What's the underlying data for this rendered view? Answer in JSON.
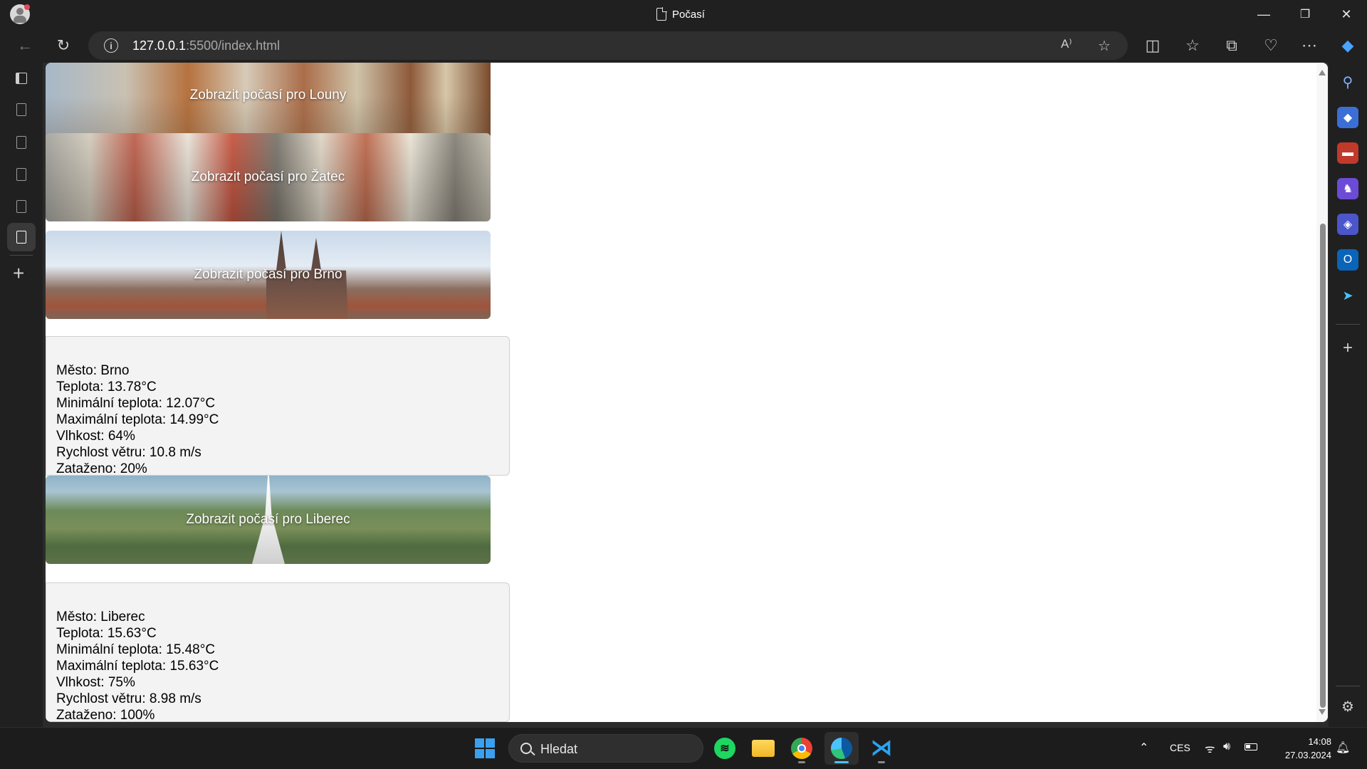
{
  "window": {
    "tab_title": "Počasí",
    "minimize": "—",
    "restore": "❐",
    "close": "✕"
  },
  "toolbar": {
    "url_host": "127.0.0.1",
    "url_rest": ":5500/index.html"
  },
  "page": {
    "banners": [
      {
        "label": "Zobrazit počasí pro Louny"
      },
      {
        "label": "Zobrazit počasí pro Žatec"
      },
      {
        "label": "Zobrazit počasí pro Brno"
      },
      {
        "label": "Zobrazit počasí pro Liberec"
      }
    ],
    "weather_brno": {
      "city": "Město: Brno",
      "temp": "Teplota: 13.78°C",
      "temp_min": "Minimální teplota: 12.07°C",
      "temp_max": "Maximální teplota: 14.99°C",
      "humidity": "Vlhkost: 64%",
      "wind": "Rychlost větru: 10.8 m/s",
      "clouds": "Zataženo: 20%"
    },
    "weather_liberec": {
      "city": "Město: Liberec",
      "temp": "Teplota: 15.63°C",
      "temp_min": "Minimální teplota: 15.48°C",
      "temp_max": "Maximální teplota: 15.63°C",
      "humidity": "Vlhkost: 75%",
      "wind": "Rychlost větru: 8.98 m/s",
      "clouds": "Zataženo: 100%"
    }
  },
  "taskbar": {
    "search_placeholder": "Hledat",
    "language": "CES",
    "time": "14:08",
    "date": "27.03.2024"
  },
  "colors": {
    "accent": "#4cc2ff",
    "page_bg": "#ffffff",
    "card_bg": "#f3f3f3",
    "chrome_bg": "#202020"
  }
}
